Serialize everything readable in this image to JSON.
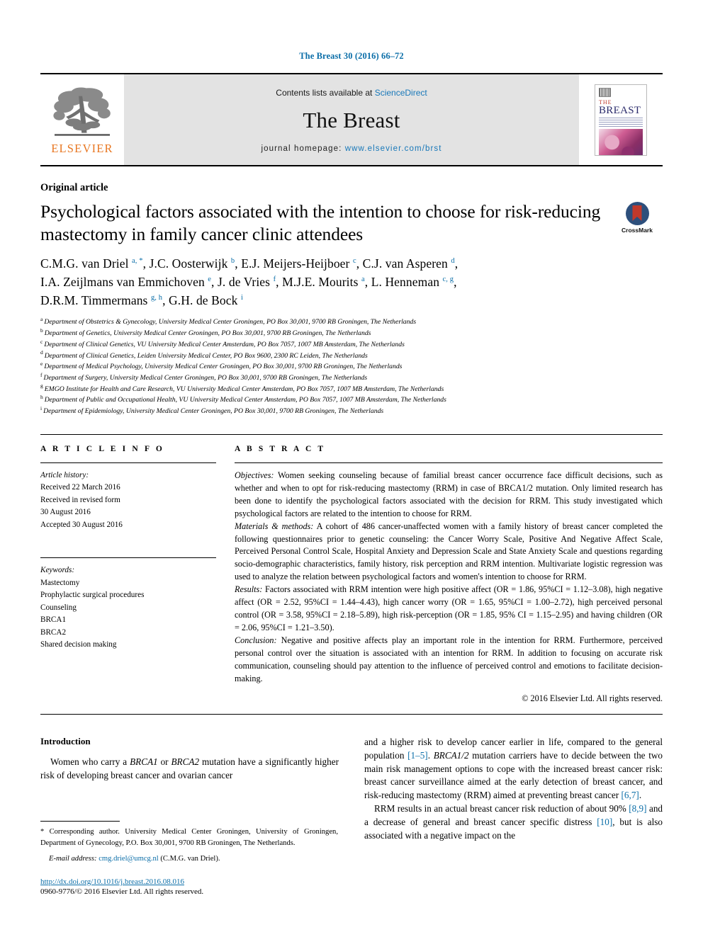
{
  "running_head": "The Breast 30 (2016) 66–72",
  "masthead": {
    "contents_prefix": "Contents lists available at ",
    "sciencedirect": "ScienceDirect",
    "journal_title": "The Breast",
    "homepage_prefix": "journal homepage: ",
    "homepage_url": "www.elsevier.com/brst",
    "publisher": "ELSEVIER",
    "cover_the": "THE",
    "cover_breast": "BREAST",
    "link_color": "#1878b9"
  },
  "article": {
    "type": "Original article",
    "title": "Psychological factors associated with the intention to choose for risk-reducing mastectomy in family cancer clinic attendees",
    "crossmark_label": "CrossMark"
  },
  "authors": {
    "line1_parts": [
      {
        "name": "C.M.G. van Driel ",
        "sup": "a, *"
      },
      {
        "name": ", J.C. Oosterwijk ",
        "sup": "b"
      },
      {
        "name": ", E.J. Meijers-Heijboer ",
        "sup": "c"
      },
      {
        "name": ", C.J. van Asperen ",
        "sup": "d"
      },
      {
        "name": ",",
        "sup": ""
      }
    ],
    "line2_parts": [
      {
        "name": "I.A. Zeijlmans van Emmichoven ",
        "sup": "e"
      },
      {
        "name": ", J. de Vries ",
        "sup": "f"
      },
      {
        "name": ", M.J.E. Mourits ",
        "sup": "a"
      },
      {
        "name": ", L. Henneman ",
        "sup": "c, g"
      },
      {
        "name": ",",
        "sup": ""
      }
    ],
    "line3_parts": [
      {
        "name": "D.R.M. Timmermans ",
        "sup": "g, h"
      },
      {
        "name": ", G.H. de Bock ",
        "sup": "i"
      }
    ]
  },
  "affiliations": [
    {
      "mark": "a",
      "text": "Department of Obstetrics & Gynecology, University Medical Center Groningen, PO Box 30,001, 9700 RB Groningen, The Netherlands"
    },
    {
      "mark": "b",
      "text": "Department of Genetics, University Medical Center Groningen, PO Box 30,001, 9700 RB Groningen, The Netherlands"
    },
    {
      "mark": "c",
      "text": "Department of Clinical Genetics, VU University Medical Center Amsterdam, PO Box 7057, 1007 MB Amsterdam, The Netherlands"
    },
    {
      "mark": "d",
      "text": "Department of Clinical Genetics, Leiden University Medical Center, PO Box 9600, 2300 RC Leiden, The Netherlands"
    },
    {
      "mark": "e",
      "text": "Department of Medical Psychology, University Medical Center Groningen, PO Box 30,001, 9700 RB Groningen, The Netherlands"
    },
    {
      "mark": "f",
      "text": "Department of Surgery, University Medical Center Groningen, PO Box 30,001, 9700 RB Groningen, The Netherlands"
    },
    {
      "mark": "g",
      "text": "EMGO Institute for Health and Care Research, VU University Medical Center Amsterdam, PO Box 7057, 1007 MB Amsterdam, The Netherlands"
    },
    {
      "mark": "h",
      "text": "Department of Public and Occupational Health, VU University Medical Center Amsterdam, PO Box 7057, 1007 MB Amsterdam, The Netherlands"
    },
    {
      "mark": "i",
      "text": "Department of Epidemiology, University Medical Center Groningen, PO Box 30,001, 9700 RB Groningen, The Netherlands"
    }
  ],
  "article_info": {
    "heading": "A R T I C L E  I N F O",
    "history_label": "Article history:",
    "history": [
      "Received 22 March 2016",
      "Received in revised form",
      "30 August 2016",
      "Accepted 30 August 2016"
    ],
    "keywords_label": "Keywords:",
    "keywords": [
      "Mastectomy",
      "Prophylactic surgical procedures",
      "Counseling",
      "BRCA1",
      "BRCA2",
      "Shared decision making"
    ]
  },
  "abstract": {
    "heading": "A B S T R A C T",
    "objectives_label": "Objectives:",
    "objectives_text": " Women seeking counseling because of familial breast cancer occurrence face difficult decisions, such as whether and when to opt for risk-reducing mastectomy (RRM) in case of BRCA1/2 mutation. Only limited research has been done to identify the psychological factors associated with the decision for RRM. This study investigated which psychological factors are related to the intention to choose for RRM.",
    "materials_label": "Materials & methods:",
    "materials_text": " A cohort of 486 cancer-unaffected women with a family history of breast cancer completed the following questionnaires prior to genetic counseling: the Cancer Worry Scale, Positive And Negative Affect Scale, Perceived Personal Control Scale, Hospital Anxiety and Depression Scale and State Anxiety Scale and questions regarding socio-demographic characteristics, family history, risk perception and RRM intention. Multivariate logistic regression was used to analyze the relation between psychological factors and women's intention to choose for RRM.",
    "results_label": "Results:",
    "results_text": " Factors associated with RRM intention were high positive affect (OR = 1.86, 95%CI = 1.12–3.08), high negative affect (OR = 2.52, 95%CI = 1.44–4.43), high cancer worry (OR = 1.65, 95%CI = 1.00–2.72), high perceived personal control (OR = 3.58, 95%CI = 2.18–5.89), high risk-perception (OR = 1.85, 95% CI = 1.15–2.95) and having children (OR = 2.06, 95%CI = 1.21–3.50).",
    "conclusion_label": "Conclusion:",
    "conclusion_text": " Negative and positive affects play an important role in the intention for RRM. Furthermore, perceived personal control over the situation is associated with an intention for RRM. In addition to focusing on accurate risk communication, counseling should pay attention to the influence of perceived control and emotions to facilitate decision-making.",
    "copyright": "© 2016 Elsevier Ltd. All rights reserved."
  },
  "body": {
    "intro_heading": "Introduction",
    "left_para_1_a": "Women who carry a ",
    "left_para_1_em1": "BRCA1",
    "left_para_1_b": " or ",
    "left_para_1_em2": "BRCA2",
    "left_para_1_c": " mutation have a significantly higher risk of developing breast cancer and ovarian cancer",
    "right_para_1_a": "and a higher risk to develop cancer earlier in life, compared to the general population ",
    "right_para_1_ref1": "[1–5]",
    "right_para_1_b": ". ",
    "right_para_1_em": "BRCA1/2",
    "right_para_1_c": " mutation carriers have to decide between the two main risk management options to cope with the increased breast cancer risk: breast cancer surveillance aimed at the early detection of breast cancer, and risk-reducing mastectomy (RRM) aimed at preventing breast cancer ",
    "right_para_1_ref2": "[6,7]",
    "right_para_1_d": ".",
    "right_para_2_a": "RRM results in an actual breast cancer risk reduction of about 90% ",
    "right_para_2_ref1": "[8,9]",
    "right_para_2_b": " and a decrease of general and breast cancer specific distress ",
    "right_para_2_ref2": "[10]",
    "right_para_2_c": ", but is also associated with a negative impact on the"
  },
  "footnotes": {
    "corresponding": "* Corresponding author. University Medical Center Groningen, University of Groningen, Department of Gynecology, P.O. Box 30,001, 9700 RB Groningen, The Netherlands.",
    "email_label": "E-mail address:",
    "email": "cmg.driel@umcg.nl",
    "email_attrib": " (C.M.G. van Driel).",
    "doi": "http://dx.doi.org/10.1016/j.breast.2016.08.016",
    "issn": "0960-9776/© 2016 Elsevier Ltd. All rights reserved."
  }
}
